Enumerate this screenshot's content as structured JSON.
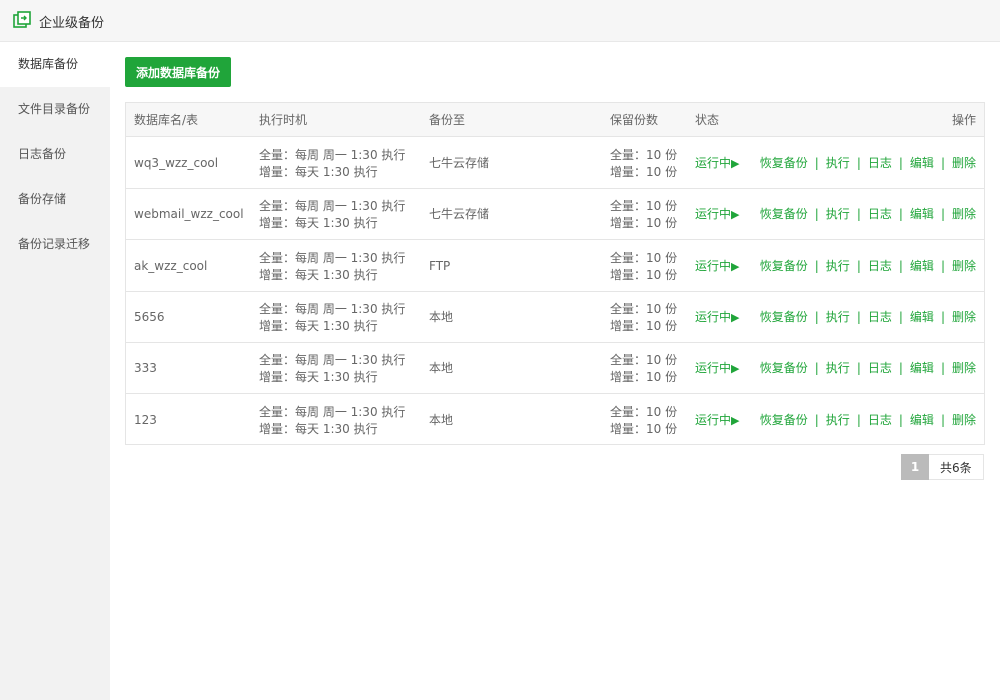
{
  "window": {
    "title": "企业级备份"
  },
  "sidebar": {
    "items": [
      {
        "label": "数据库备份",
        "active": true
      },
      {
        "label": "文件目录备份",
        "active": false
      },
      {
        "label": "日志备份",
        "active": false
      },
      {
        "label": "备份存储",
        "active": false
      },
      {
        "label": "备份记录迁移",
        "active": false
      }
    ]
  },
  "toolbar": {
    "add_label": "添加数据库备份"
  },
  "table": {
    "headers": {
      "name": "数据库名/表",
      "time": "执行时机",
      "dest": "备份至",
      "keep": "保留份数",
      "status": "状态",
      "ops": "操作"
    },
    "rows": [
      {
        "name": "wq3_wzz_cool",
        "time_full": "全量：每周 周一 1:30 执行",
        "time_inc": "增量：每天 1:30 执行",
        "dest": "七牛云存储",
        "keep_full": "全量：10 份",
        "keep_inc": "增量：10 份",
        "status": "运行中",
        "status_icon": "▶"
      },
      {
        "name": "webmail_wzz_cool",
        "time_full": "全量：每周 周一 1:30 执行",
        "time_inc": "增量：每天 1:30 执行",
        "dest": "七牛云存储",
        "keep_full": "全量：10 份",
        "keep_inc": "增量：10 份",
        "status": "运行中",
        "status_icon": "▶"
      },
      {
        "name": "ak_wzz_cool",
        "time_full": "全量：每周 周一 1:30 执行",
        "time_inc": "增量：每天 1:30 执行",
        "dest": "FTP",
        "keep_full": "全量：10 份",
        "keep_inc": "增量：10 份",
        "status": "运行中",
        "status_icon": "▶"
      },
      {
        "name": "5656",
        "time_full": "全量：每周 周一 1:30 执行",
        "time_inc": "增量：每天 1:30 执行",
        "dest": "本地",
        "keep_full": "全量：10 份",
        "keep_inc": "增量：10 份",
        "status": "运行中",
        "status_icon": "▶"
      },
      {
        "name": "333",
        "time_full": "全量：每周 周一 1:30 执行",
        "time_inc": "增量：每天 1:30 执行",
        "dest": "本地",
        "keep_full": "全量：10 份",
        "keep_inc": "增量：10 份",
        "status": "运行中",
        "status_icon": "▶"
      },
      {
        "name": "123",
        "time_full": "全量：每周 周一 1:30 执行",
        "time_inc": "增量：每天 1:30 执行",
        "dest": "本地",
        "keep_full": "全量：10 份",
        "keep_inc": "增量：10 份",
        "status": "运行中",
        "status_icon": "▶"
      }
    ],
    "actions": {
      "restore": "恢复备份",
      "run": "执行",
      "log": "日志",
      "edit": "编辑",
      "delete": "删除",
      "separator": "|"
    }
  },
  "pagination": {
    "current": "1",
    "total_text": "共6条"
  },
  "colors": {
    "accent": "#20a53a",
    "sidebar_bg": "#f2f2f2",
    "titlebar_bg": "#f6f6f6"
  }
}
